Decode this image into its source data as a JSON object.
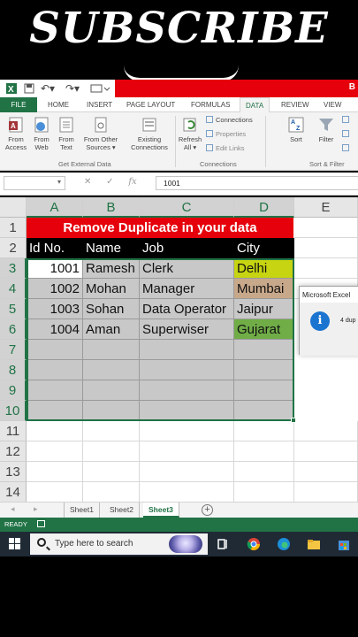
{
  "banner": {
    "text": "SUBSCRIBE"
  },
  "ribbon_tabs": {
    "file": "FILE",
    "home": "HOME",
    "insert": "INSERT",
    "page_layout": "PAGE LAYOUT",
    "formulas": "FORMULAS",
    "data": "DATA",
    "review": "REVIEW",
    "view": "VIEW"
  },
  "ribbon": {
    "from_access": [
      "From",
      "Access"
    ],
    "from_web": [
      "From",
      "Web"
    ],
    "from_text": [
      "From",
      "Text"
    ],
    "from_other": [
      "From Other",
      "Sources ▾"
    ],
    "existing": [
      "Existing",
      "Connections"
    ],
    "refresh": [
      "Refresh",
      "All ▾"
    ],
    "connections": "Connections",
    "properties": "Properties",
    "edit_links": "Edit Links",
    "sort": "Sort",
    "filter": "Filter",
    "group_external": "Get External Data",
    "group_connections": "Connections",
    "group_sort": "Sort & Filter"
  },
  "formula_bar": {
    "name_box": "",
    "value": "1001"
  },
  "columns": [
    "A",
    "B",
    "C",
    "D",
    "E"
  ],
  "rows": [
    "1",
    "2",
    "3",
    "4",
    "5",
    "6",
    "7",
    "8",
    "9",
    "10",
    "11",
    "12",
    "13",
    "14"
  ],
  "sheet": {
    "title": "Remove Duplicate in your data",
    "headers": [
      "Id No.",
      "Name",
      "Job",
      "City"
    ],
    "records": [
      {
        "id": "1001",
        "name": "Ramesh",
        "job": "Clerk",
        "city": "Delhi",
        "city_color": "#c6d411"
      },
      {
        "id": "1002",
        "name": "Mohan",
        "job": "Manager",
        "city": "Mumbai",
        "city_color": "#c8a88a"
      },
      {
        "id": "1003",
        "name": "Sohan",
        "job": "Data Operator",
        "city": "Jaipur",
        "city_color": "#c8c8c8"
      },
      {
        "id": "1004",
        "name": "Aman",
        "job": "Superwiser",
        "city": "Gujarat",
        "city_color": "#70ad47"
      }
    ]
  },
  "dialog": {
    "title": "Microsoft Excel",
    "message": "4 dup"
  },
  "sheet_tabs": [
    "Sheet1",
    "Sheet2",
    "Sheet3"
  ],
  "status": {
    "text": "READY"
  },
  "taskbar": {
    "search_placeholder": "Type here to search"
  },
  "colors": {
    "excel_green": "#217346",
    "title_red": "#e5000b",
    "header_black": "#000000"
  }
}
